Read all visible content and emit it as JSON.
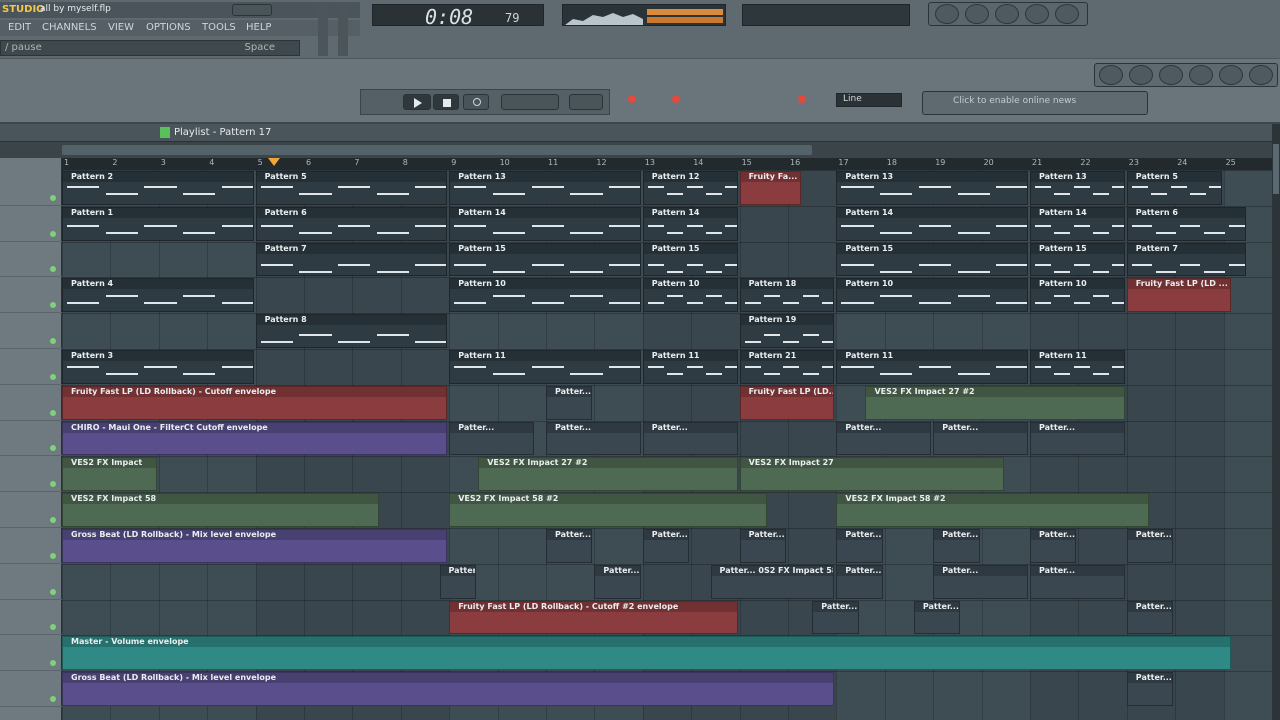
{
  "app": {
    "logo": "STUDIO",
    "file_title": "all by myself.flp",
    "time_display": "0:08",
    "time_frames": "79"
  },
  "menu": {
    "items": [
      "EDIT",
      "CHANNELS",
      "VIEW",
      "OPTIONS",
      "TOOLS",
      "HELP"
    ],
    "hint_left": "/ pause",
    "hint_right": "Space"
  },
  "transport": {
    "online_news": "Click to enable online news",
    "line_mode": "Line"
  },
  "playlist": {
    "title": "Playlist - Pattern 17",
    "bars": [
      "1",
      "2",
      "3",
      "4",
      "5",
      "6",
      "7",
      "8",
      "9",
      "10",
      "11",
      "12",
      "13",
      "14",
      "15",
      "16",
      "17",
      "18",
      "19",
      "20",
      "21",
      "22",
      "23",
      "24",
      "25"
    ],
    "tracks": 15
  },
  "clips": {
    "p2": "Pattern 2",
    "p5": "Pattern 5",
    "p13": "Pattern 13",
    "p12": "Pattern 12",
    "fruity_fa": "Fruity Fa...",
    "p1": "Pattern 1",
    "p6": "Pattern 6",
    "p14": "Pattern 14",
    "p7": "Pattern 7",
    "p15": "Pattern 15",
    "p4": "Pattern 4",
    "p10": "Pattern 10",
    "p18": "Pattern 18",
    "fruity_fast_lp": "Fruity Fast LP (LD ...",
    "p8": "Pattern 8",
    "p19": "Pattern 19",
    "p3": "Pattern 3",
    "p11": "Pattern 11",
    "p21": "Pattern 21",
    "fruity_cutoff": "Fruity Fast LP (LD Rollback) - Cutoff envelope",
    "patter": "Patter...",
    "fruity_fast_lp_short": "Fruity Fast LP (LD...",
    "vesz_impact27_2": "VES2 FX Impact 27 #2",
    "chiro": "CHIRO - Maui One - FilterCt Cutoff envelope",
    "vesz_impact": "VES2 FX Impact",
    "vesz_impact27": "VES2 FX Impact 27",
    "vesz_impact58": "VES2 FX Impact 58",
    "vesz_impact58_2": "VES2 FX Impact 58 #2",
    "gross_beat": "Gross Beat (LD Rollback) - Mix level envelope",
    "vesz_impact58_short": "Patter... 0S2 FX Impact 58",
    "fruity_cutoff2": "Fruity Fast LP (LD Rollback) - Cutoff #2 envelope",
    "master": "Master - Volume envelope",
    "gross_beat2": "Gross Beat (LD Rollback) - Mix level envelope"
  }
}
